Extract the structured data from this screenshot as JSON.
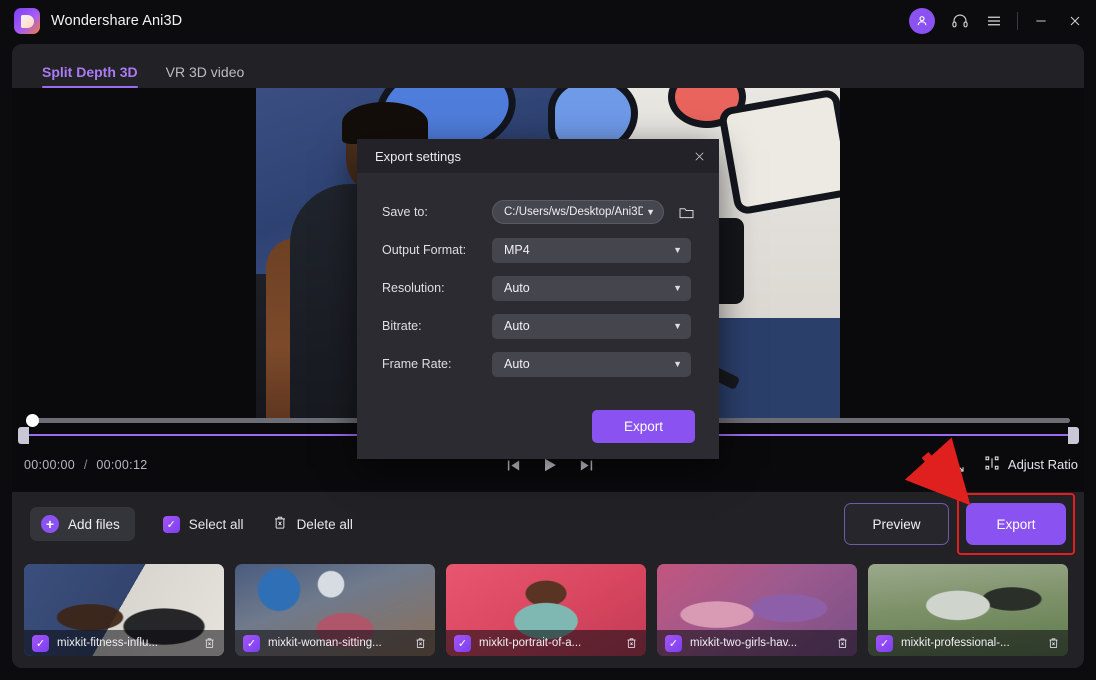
{
  "window": {
    "title": "Wondershare Ani3D",
    "logo_icon": "wondershare-logo-icon",
    "controls": {
      "avatar": "user-avatar-icon",
      "support": "headset-icon",
      "menu": "hamburger-menu-icon",
      "minimize": "minimize-icon",
      "close": "close-icon"
    }
  },
  "tabs": [
    {
      "label": "Split Depth 3D",
      "active": true
    },
    {
      "label": "VR 3D video",
      "active": false
    }
  ],
  "player": {
    "current_time": "00:00:00",
    "separator": "/",
    "total_time": "00:00:12",
    "prev_frame_icon": "previous-frame-icon",
    "play_icon": "play-icon",
    "next_frame_icon": "next-frame-icon",
    "fullscreen_icon": "fullscreen-icon",
    "adjust_ratio_label": "Adjust Ratio",
    "adjust_ratio_icon": "crop-ratio-icon"
  },
  "toolbar": {
    "add_files_label": "Add files",
    "add_files_icon": "plus-circle-icon",
    "select_all_label": "Select all",
    "select_all_checked": true,
    "delete_all_label": "Delete all",
    "delete_all_icon": "trash-icon",
    "preview_label": "Preview",
    "export_label": "Export"
  },
  "dialog": {
    "title": "Export settings",
    "close_icon": "close-icon",
    "fields": [
      {
        "label": "Save to:",
        "value": "C:/Users/ws/Desktop/Ani3D",
        "type": "path"
      },
      {
        "label": "Output Format:",
        "value": "MP4",
        "type": "select"
      },
      {
        "label": "Resolution:",
        "value": "Auto",
        "type": "select"
      },
      {
        "label": "Bitrate:",
        "value": "Auto",
        "type": "select"
      },
      {
        "label": "Frame Rate:",
        "value": "Auto",
        "type": "select"
      }
    ],
    "browse_icon": "folder-icon",
    "export_button": "Export"
  },
  "thumbnails": [
    {
      "name": "mixkit-fitness-influ...",
      "selected": true,
      "checked": true
    },
    {
      "name": "mixkit-woman-sitting...",
      "selected": false,
      "checked": true
    },
    {
      "name": "mixkit-portrait-of-a...",
      "selected": false,
      "checked": true
    },
    {
      "name": "mixkit-two-girls-hav...",
      "selected": false,
      "checked": true
    },
    {
      "name": "mixkit-professional-...",
      "selected": false,
      "checked": true
    }
  ],
  "colors": {
    "accent": "#8a52f0",
    "accent_text": "#ab7bf5",
    "panel": "#212126",
    "window_bg": "#0c0c0e",
    "annotation_red": "#e01f1f"
  }
}
